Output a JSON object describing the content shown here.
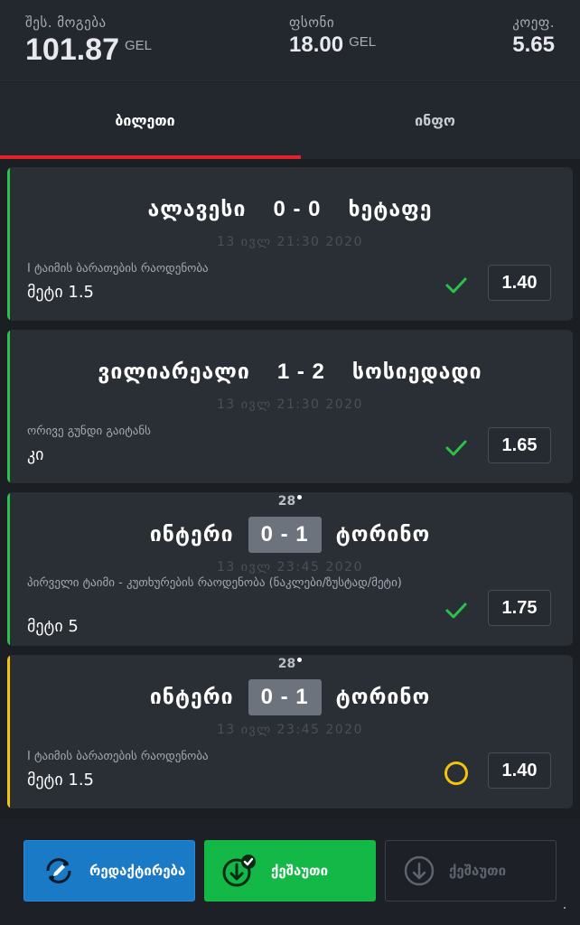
{
  "header": {
    "possible_win": {
      "label": "შეს. მოგება",
      "value": "101.87",
      "currency": "GEL"
    },
    "price": {
      "label": "ფსონი",
      "value": "18.00",
      "currency": "GEL"
    },
    "coef": {
      "label": "კოეფ.",
      "value": "5.65"
    }
  },
  "tabs": [
    {
      "label": "ბილეთი",
      "active": true
    },
    {
      "label": "ინფო",
      "active": false
    }
  ],
  "colors": {
    "accent_won": "#2ac24b",
    "accent_pending": "#f2c40f",
    "tab_underline": "#e1222c",
    "edit_button": "#1a7ac6",
    "cashout_button": "#14b847"
  },
  "bets": [
    {
      "status": "won",
      "status_icon": "check-icon",
      "home": "ალავესი",
      "score": "0 - 0",
      "away": "ხეტაფე",
      "minute": "",
      "live": false,
      "date": "13 ივლ 21:30 2020",
      "market": "I ტაიმის ბარათების რაოდენობა",
      "pick": "მეტი 1.5",
      "odd": "1.40"
    },
    {
      "status": "won",
      "status_icon": "check-icon",
      "home": "ვილიარეალი",
      "score": "1 - 2",
      "away": "სოსიედადი",
      "minute": "",
      "live": false,
      "date": "13 ივლ 21:30 2020",
      "market": "ორივე გუნდი გაიტანს",
      "pick": "კი",
      "odd": "1.65"
    },
    {
      "status": "won",
      "status_icon": "check-icon",
      "home": "ინტერი",
      "score": "0 - 1",
      "away": "ტორინო",
      "minute": "28",
      "live": true,
      "date": "13 ივლ 23:45 2020",
      "market": "პირველი ტაიმი - კუთხურების რაოდენობა (ნაკლები/ზუსტად/მეტი)",
      "pick": "მეტი 5",
      "odd": "1.75"
    },
    {
      "status": "pending",
      "status_icon": "pending-circle-icon",
      "home": "ინტერი",
      "score": "0 - 1",
      "away": "ტორინო",
      "minute": "28",
      "live": true,
      "date": "13 ივლ 23:45 2020",
      "market": "I ტაიმის ბარათების რაოდენობა",
      "pick": "მეტი 1.5",
      "odd": "1.40"
    }
  ],
  "buttons": {
    "edit": "რედაქტირება",
    "cashout": "ქეშაუთი",
    "cashout_disabled": "ქეშაუთი"
  }
}
